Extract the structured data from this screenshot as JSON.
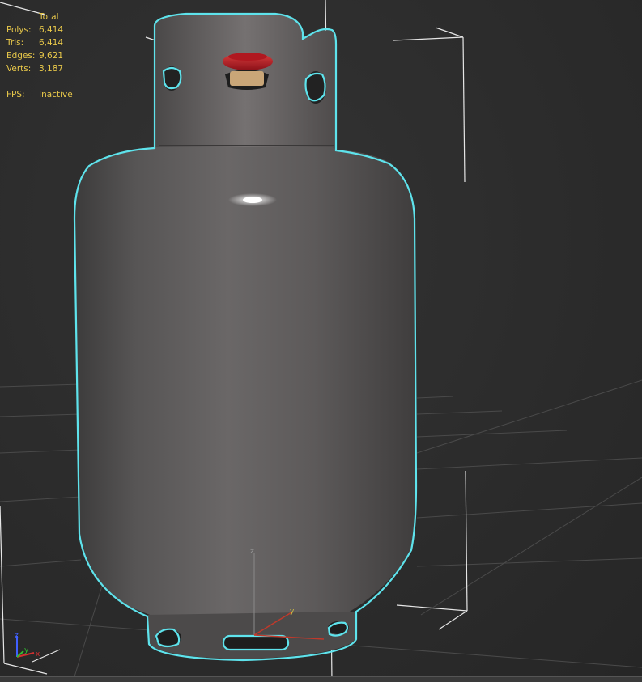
{
  "viewport": {
    "name": "Perspective viewport",
    "background": "#2b2b2b",
    "selection_color": "#5ee3ec",
    "gizmo_color": "#e6e6e6"
  },
  "stats": {
    "header": "Total",
    "rows": [
      {
        "label": "Polys:",
        "value": "6,414"
      },
      {
        "label": "Tris:",
        "value": "6,414"
      },
      {
        "label": "Edges:",
        "value": "9,621"
      },
      {
        "label": "Verts:",
        "value": "3,187"
      }
    ],
    "fps_label": "FPS:",
    "fps_value": "Inactive",
    "color": "#e8c84a"
  },
  "object": {
    "type": "propane tank",
    "body_color": "#5a5858",
    "valve_color": "#c8202a",
    "selected": true
  },
  "axis_gizmo": {
    "x_label": "x",
    "y_label": "y",
    "z_label": "z",
    "x_color": "#d03030",
    "y_color": "#30c030",
    "z_color": "#4060ff"
  },
  "pivot_gizmo": {
    "y_label": "y",
    "z_label": "z"
  }
}
